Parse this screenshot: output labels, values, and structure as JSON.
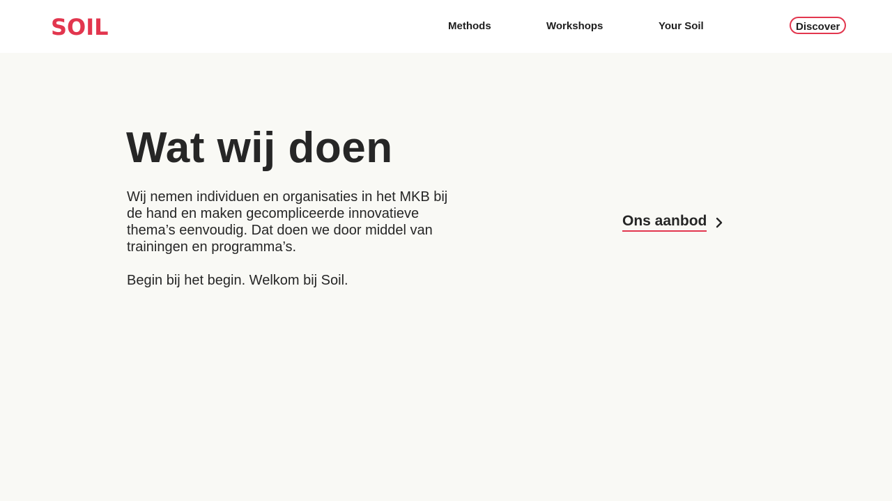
{
  "brand": {
    "logo_text": "SOIL",
    "accent_color": "#e2364e"
  },
  "nav": {
    "items": [
      {
        "label": "Methods"
      },
      {
        "label": "Workshops"
      },
      {
        "label": "Your Soil"
      }
    ],
    "cta_label": "Discover"
  },
  "hero": {
    "title": "Wat wij doen",
    "intro": "Wij nemen individuen en organisaties in het MKB bij de hand en maken gecompliceerde innovatieve thema’s eenvoudig. Dat doen we door middel van trainingen en programma’s.",
    "welcome": "Begin bij het begin. Welkom bij Soil.",
    "link_label": "Ons aanbod",
    "link_icon": "chevron-right-icon"
  }
}
